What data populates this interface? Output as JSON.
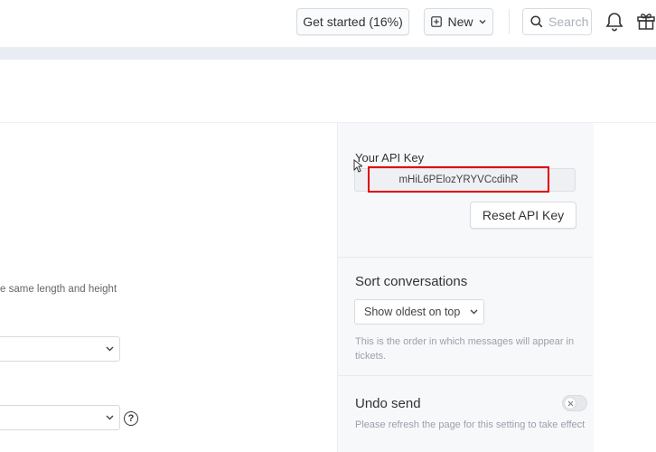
{
  "header": {
    "get_started_label": "Get started (16%)",
    "new_label": "New",
    "search_placeholder": "Search"
  },
  "left": {
    "description_fragment": "e same length and height",
    "select1_value": "",
    "select2_value": ""
  },
  "api_key": {
    "title": "Your API Key",
    "value": "mHiL6PElozYRYVCcdihR",
    "reset_label": "Reset API Key"
  },
  "sort": {
    "title": "Sort conversations",
    "selected": "Show oldest on top",
    "help": "This is the order in which messages will appear in tickets."
  },
  "undo": {
    "title": "Undo send",
    "help": "Please refresh the page for this setting to take effect"
  },
  "icons": {
    "new": "plus-square-icon",
    "search": "search-icon",
    "bell": "bell-icon",
    "gift": "gift-icon",
    "help": "question-circle-icon"
  },
  "colors": {
    "highlight": "#e00000",
    "panel_bg": "#f7f8fa"
  }
}
